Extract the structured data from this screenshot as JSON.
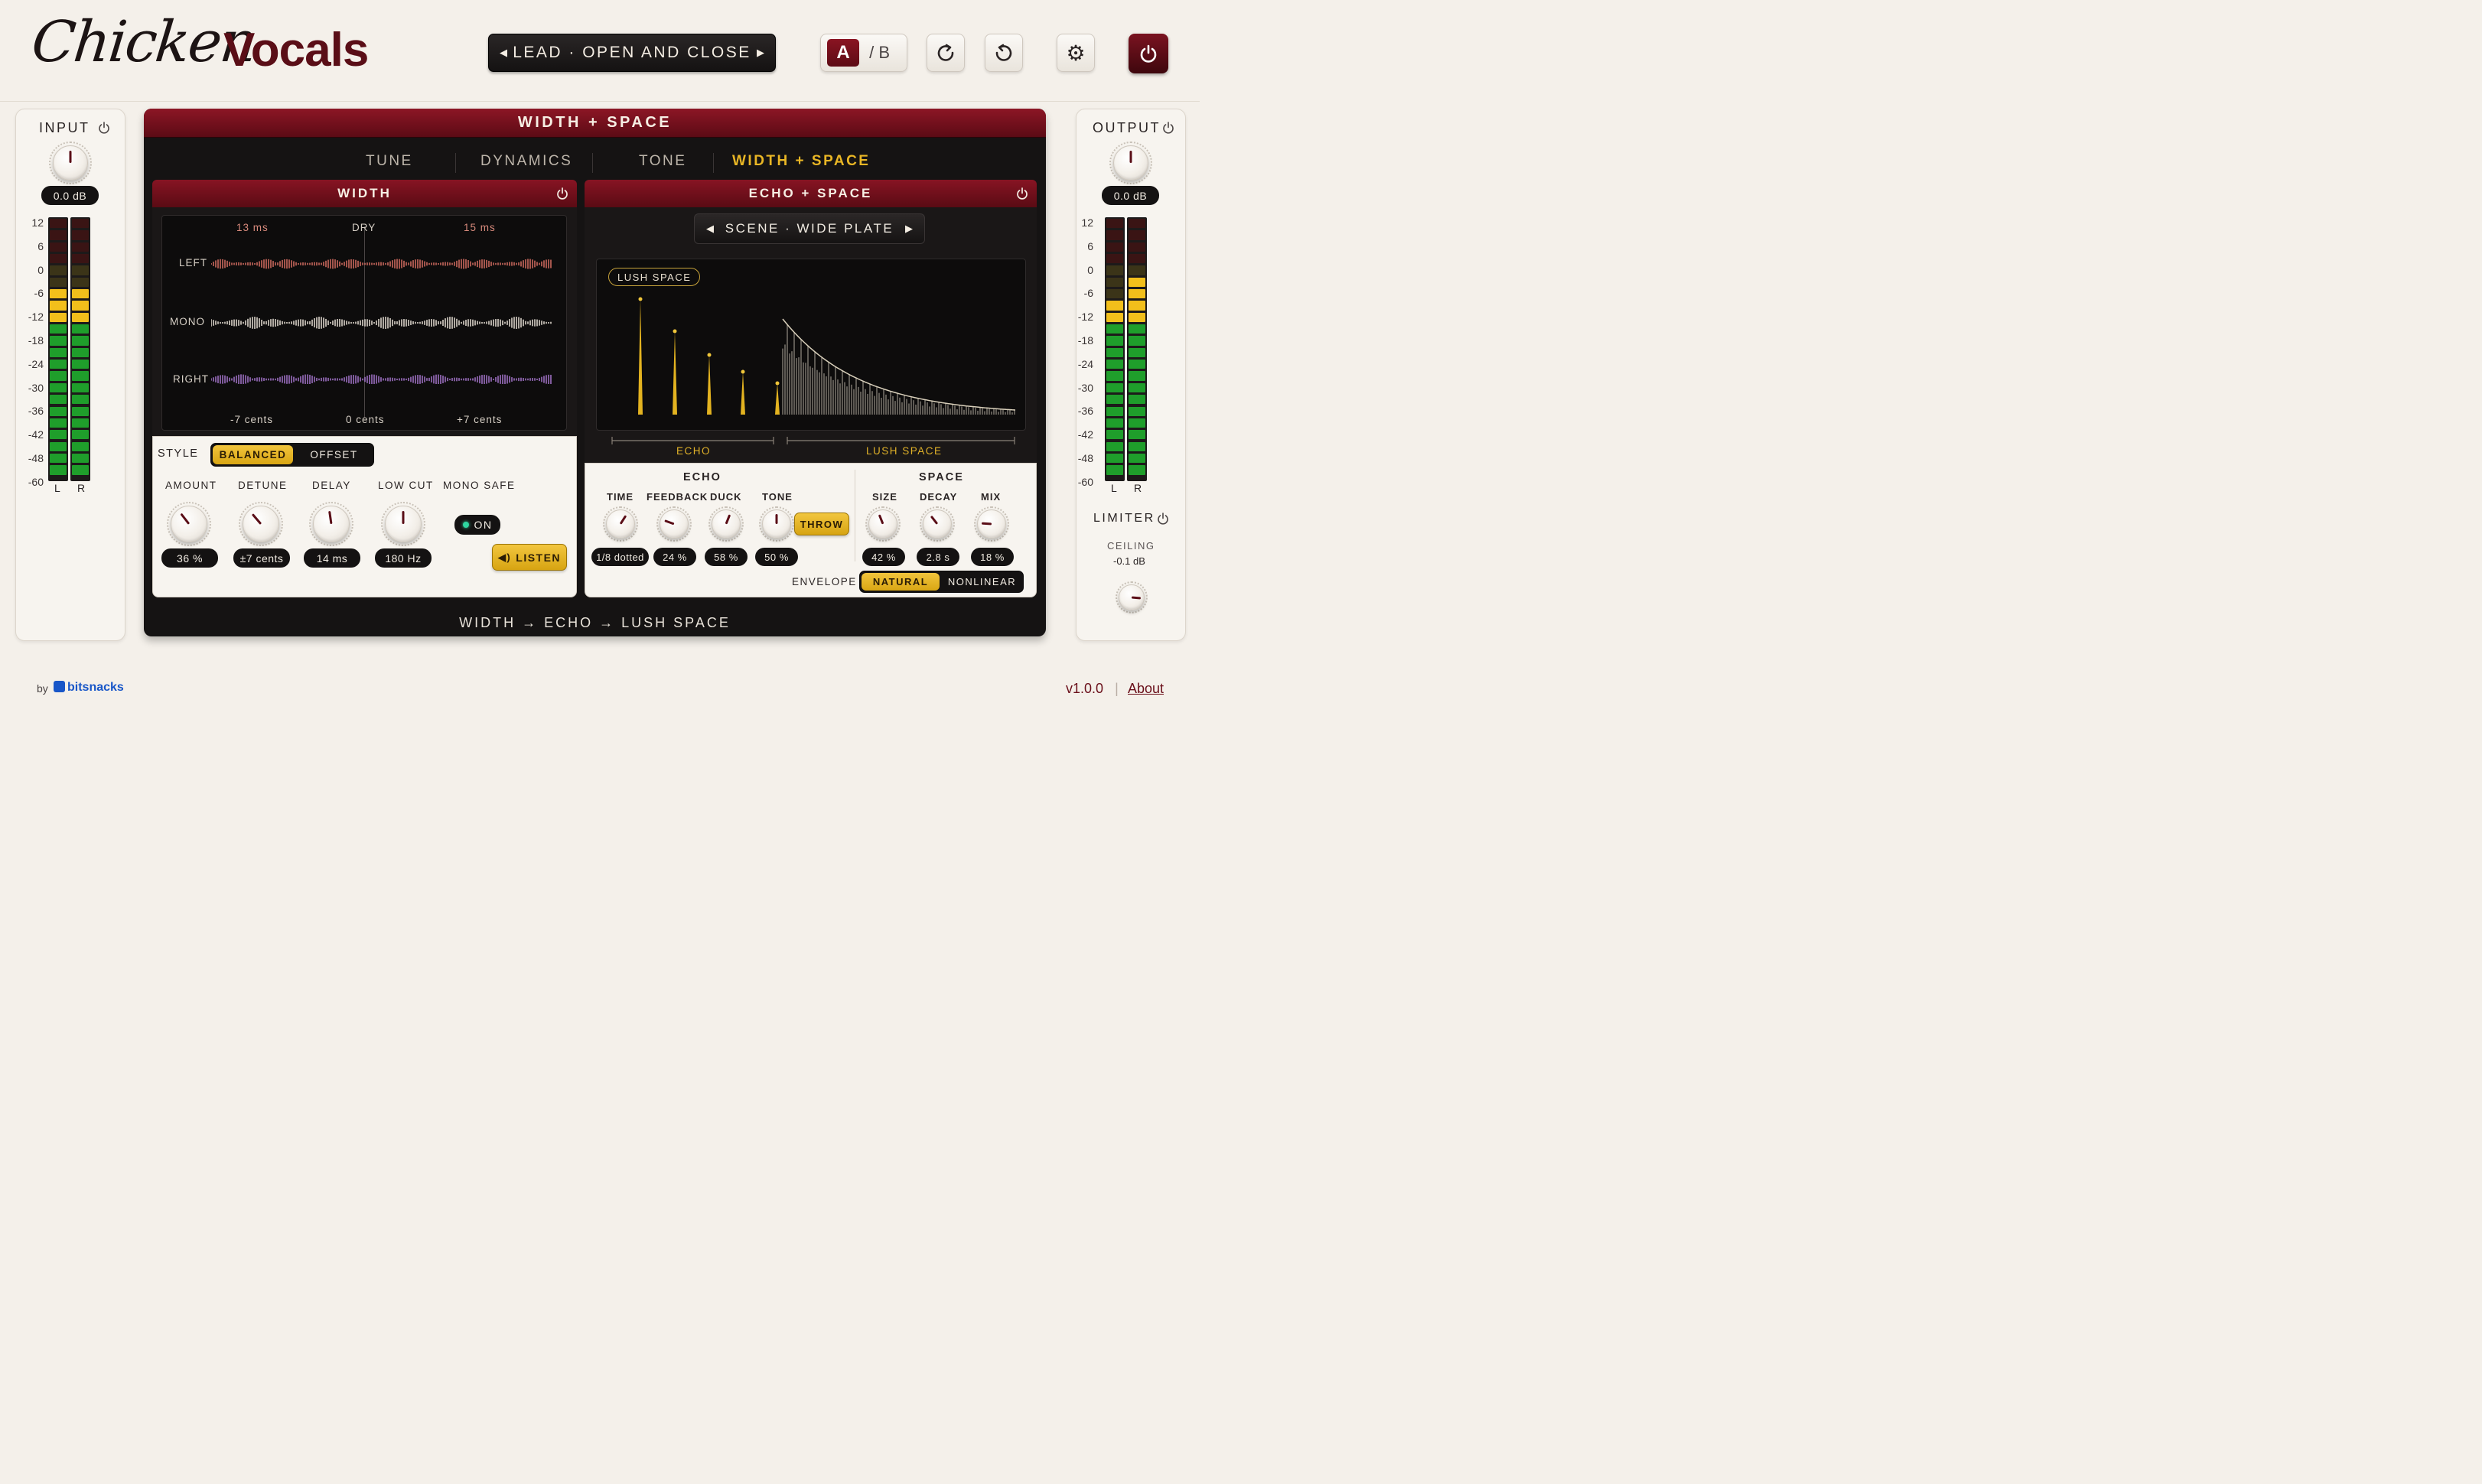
{
  "brand": {
    "script": "Chicken",
    "bold": "Vocals"
  },
  "preset": {
    "name": "LEAD · OPEN AND CLOSE"
  },
  "ab": {
    "a": "A",
    "b": "/ B"
  },
  "input": {
    "title": "INPUT",
    "value": "0.0 dB",
    "knob_level": 0.5
  },
  "output": {
    "title": "OUTPUT",
    "value": "0.0 dB",
    "knob_level": 0.5,
    "limiter": {
      "title": "LIMITER",
      "ceiling_label": "CEILING",
      "ceiling_value": "-0.1 dB",
      "knob_level": 0.85
    }
  },
  "meter_scale": [
    "12",
    "6",
    "0",
    "-6",
    "-12",
    "-18",
    "-24",
    "-30",
    "-36",
    "-42",
    "-48",
    "-60"
  ],
  "meter_channels": [
    "L",
    "R"
  ],
  "meters": {
    "input": {
      "L": 16,
      "R": 16
    },
    "output": {
      "L": 15,
      "R": 17
    }
  },
  "main": {
    "title": "WIDTH + SPACE"
  },
  "tabs": [
    {
      "label": "TUNE",
      "active": false
    },
    {
      "label": "DYNAMICS",
      "active": false
    },
    {
      "label": "TONE",
      "active": false
    },
    {
      "label": "WIDTH + SPACE",
      "active": true
    }
  ],
  "width": {
    "title": "WIDTH",
    "scope": {
      "top_left": "13 ms",
      "top_center": "DRY",
      "top_right": "15 ms",
      "rows": [
        "LEFT",
        "MONO",
        "RIGHT"
      ],
      "bottom_left": "-7 cents",
      "bottom_center": "0 cents",
      "bottom_right": "+7 cents"
    },
    "style_label": "STYLE",
    "style_options": [
      "BALANCED",
      "OFFSET"
    ],
    "style_selected": "BALANCED",
    "controls": [
      {
        "label": "AMOUNT",
        "value": "36 %",
        "level": 0.36
      },
      {
        "label": "DETUNE",
        "value": "±7 cents",
        "level": 0.35
      },
      {
        "label": "DELAY",
        "value": "14 ms",
        "level": 0.47
      },
      {
        "label": "LOW CUT",
        "value": "180 Hz",
        "level": 0.5
      }
    ],
    "mono_safe": {
      "label": "MONO SAFE",
      "state": "ON"
    },
    "listen": "LISTEN"
  },
  "echo_space": {
    "title": "ECHO + SPACE",
    "scene": "SCENE · WIDE PLATE",
    "badge": "LUSH SPACE",
    "bracket_labels": [
      "ECHO",
      "LUSH SPACE"
    ],
    "echo": {
      "title": "ECHO",
      "controls": [
        {
          "label": "TIME",
          "value": "1/8 dotted",
          "level": 0.62
        },
        {
          "label": "FEEDBACK",
          "value": "24 %",
          "level": 0.24
        },
        {
          "label": "DUCK",
          "value": "58 %",
          "level": 0.58
        },
        {
          "label": "TONE",
          "value": "50 %",
          "level": 0.5
        }
      ],
      "throw": "THROW"
    },
    "space": {
      "title": "SPACE",
      "controls": [
        {
          "label": "SIZE",
          "value": "42 %",
          "level": 0.42
        },
        {
          "label": "DECAY",
          "value": "2.8 s",
          "level": 0.36
        },
        {
          "label": "MIX",
          "value": "18 %",
          "level": 0.18
        }
      ]
    },
    "envelope_label": "ENVELOPE",
    "envelope_options": [
      "NATURAL",
      "NONLINEAR"
    ],
    "envelope_selected": "NATURAL"
  },
  "chain": "WIDTH → ECHO → LUSH SPACE",
  "footer": {
    "by": "by",
    "brand": "bitsnacks",
    "version": "v1.0.0",
    "separator": "|",
    "about": "About"
  },
  "colors": {
    "accent": "#e9b625",
    "brand": "#6a0f1a",
    "meter_green": "#1f9e2b",
    "meter_yellow": "#f2bf1b"
  }
}
